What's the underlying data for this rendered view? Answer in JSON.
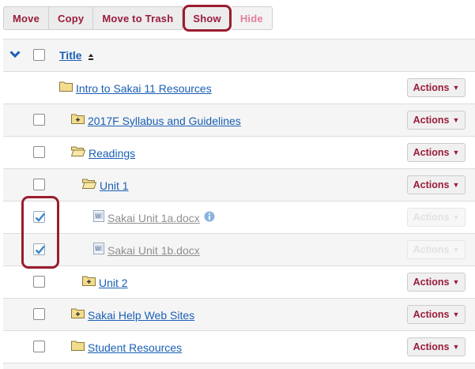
{
  "toolbar": {
    "move": "Move",
    "copy": "Copy",
    "move_to_trash": "Move to Trash",
    "show": "Show",
    "hide": "Hide"
  },
  "table": {
    "header_title": "Title",
    "actions_label": "Actions",
    "rows": [
      {
        "name": "Intro to Sakai 11 Resources"
      },
      {
        "name": "2017F Syllabus and Guidelines"
      },
      {
        "name": "Readings"
      },
      {
        "name": "Unit 1"
      },
      {
        "name": "Sakai Unit 1a.docx"
      },
      {
        "name": "Sakai Unit 1b.docx"
      },
      {
        "name": "Unit 2"
      },
      {
        "name": "Sakai Help Web Sites"
      },
      {
        "name": "Student Resources"
      }
    ]
  },
  "colors": {
    "accent": "#9a1c3c",
    "link": "#1a5fb4",
    "highlight_border": "#9a1c2e"
  }
}
